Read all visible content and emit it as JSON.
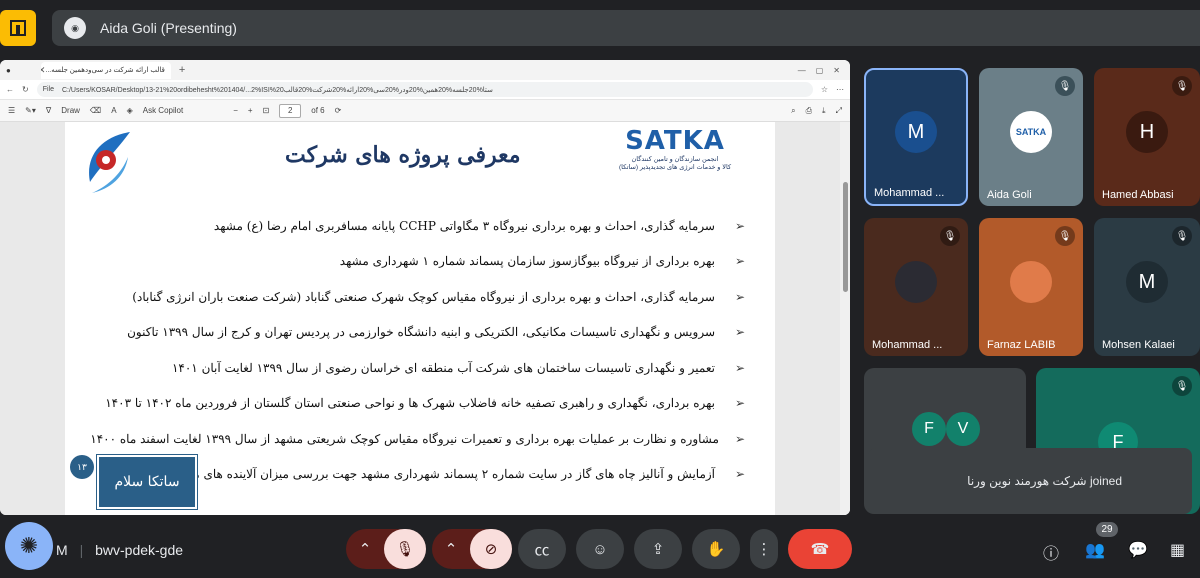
{
  "presenting": {
    "name": "Aida Goli (Presenting)"
  },
  "browser": {
    "tab_title": "قالب ارائه شرکت در سی‌ودهمین جلسه...",
    "url_label": "File",
    "url": "C:/Users/KOSAR/Desktop/13-21%20ordibehesht%201404/...2%ISI\u0006سه%20ـجلسه%20مين‌همِودریی...",
    "url_display": "C:/Users/KOSAR/Desktop/13-21%20ordibehesht%201404/...2%ISI%20ستا%20جلسه%20همین%20ودر%20سی%20ارائه%20شرکت%20قالب",
    "draw_label": "Draw",
    "copilot_label": "Ask Copilot",
    "page_current": "2",
    "page_total": "of 6"
  },
  "slide": {
    "title": "معرفی پروژه های شرکت",
    "brand": "SATKA",
    "brand_sub1": "انجمن سازندگان و تامین کنندگان",
    "brand_sub2": "کالا و خدمات انرژی های تجدیدپذیر (ساتکا)",
    "bullets": [
      "سرمایه گذاری، احداث و بهره برداری نیروگاه ۳ مگاواتی CCHP پایانه مسافربری امام رضا (ع) مشهد",
      "بهره برداری از نیروگاه بیوگازسوز سازمان پسماند شماره ۱ شهرداری مشهد",
      "سرمایه گذاری، احداث و بهره برداری از نیروگاه مقیاس کوچک شهرک صنعتی گناباد (شرکت صنعت باران انرژی گناباد)",
      "سرویس و نگهداری تاسیسات مکانیکی، الکتریکی و ابنیه دانشگاه خوارزمی در پردیس تهران و کرج از سال ۱۳۹۹ تاکنون",
      "تعمیر و نگهداری تاسیسات ساختمان های شرکت آب منطقه ای خراسان رضوی از سال ۱۳۹۹ لغایت آبان ۱۴۰۱",
      "بهره برداری، نگهداری و راهبری تصفیه خانه فاضلاب شهرک ها و نواحی صنعتی استان گلستان از فروردین ماه ۱۴۰۲ تا ۱۴۰۳",
      "مشاوره و نظارت بر عملیات بهره برداری و تعمیرات نیروگاه مقیاس کوچک شریعتی مشهد از سال ۱۳۹۹ لغایت اسفند ماه ۱۴۰۰",
      "آزمایش و آنالیز چاه های گاز در سایت شماره ۲ پسماند شهرداری مشهد جهت بررسی میزان آلاینده های مخرب"
    ],
    "stamp_text": "ساتکا سلام",
    "stamp_num": "۱۳"
  },
  "participants": [
    {
      "name": "Mohammad ...",
      "initial": "M",
      "bg": "#1a73e8",
      "muted": false
    },
    {
      "name": "Aida Goli",
      "initial": "",
      "bg": "#6b7f88",
      "muted": true
    },
    {
      "name": "Hamed Abbasi",
      "initial": "H",
      "bg": "#5a2a1a",
      "muted": true
    },
    {
      "name": "Mohammad ...",
      "initial": "",
      "bg": "#4a2a1e",
      "muted": true
    },
    {
      "name": "Farnaz LABIB",
      "initial": "",
      "bg": "#b25a2a",
      "muted": true
    },
    {
      "name": "Mohsen Kalaei",
      "initial": "M",
      "bg": "#2b3b44",
      "muted": true
    }
  ],
  "overflow_tile": {
    "initials": [
      "F",
      "V"
    ]
  },
  "last_tile": {
    "initial": "F"
  },
  "toast": {
    "text": "شرکت هورمند نوین ورنا joined"
  },
  "meeting": {
    "code": "bwv-pdek-gde",
    "prefix": "M"
  },
  "people_count": "29",
  "colors": {
    "accent": "#8ab4f8",
    "danger": "#ea4335",
    "mute_bg": "#f9dedc",
    "bar": "#202124"
  }
}
